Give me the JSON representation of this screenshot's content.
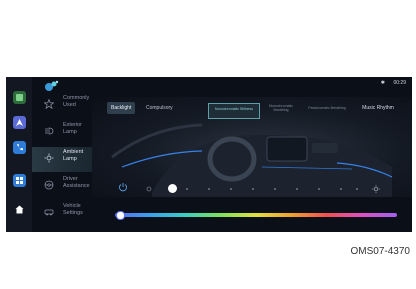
{
  "status": {
    "time": "00:29",
    "bluetooth_icon": "bluetooth-icon"
  },
  "sidebar_apps": [
    {
      "icon": "home-square-icon",
      "color": "#2e6b3a"
    },
    {
      "icon": "navigation-icon",
      "color": "#5b6bd6"
    },
    {
      "icon": "phone-icon",
      "color": "#2f7bd8"
    },
    {
      "icon": "apps-grid-icon",
      "color": "#2f7bd8"
    },
    {
      "icon": "house-icon",
      "color": "#121722"
    }
  ],
  "menu": {
    "items": [
      {
        "label": "Commonly Used",
        "icon": "star-icon"
      },
      {
        "label": "Exterior Lamp",
        "icon": "exterior-lamp-icon"
      },
      {
        "label": "Ambient Lamp",
        "icon": "ambient-lamp-icon",
        "active": true
      },
      {
        "label": "Driver Assistance",
        "icon": "driver-assistance-icon"
      },
      {
        "label": "Vehicle Settings",
        "icon": "vehicle-settings-icon"
      }
    ]
  },
  "tabs": {
    "backlight": "Backlight",
    "compulsory": "Compulsory"
  },
  "modes": {
    "mono_still": "Monochromatic Stillness",
    "mono_breath": "Monochromatic Breathing",
    "pano_breath": "Panchromatic Breathing",
    "music_rhythm": "Music Rhythm"
  },
  "brightness": {
    "level": 0.05
  },
  "color_slider": {
    "position": 0.0
  },
  "accent_color": "#3a8cff",
  "figure_code": "OMS07-4370"
}
